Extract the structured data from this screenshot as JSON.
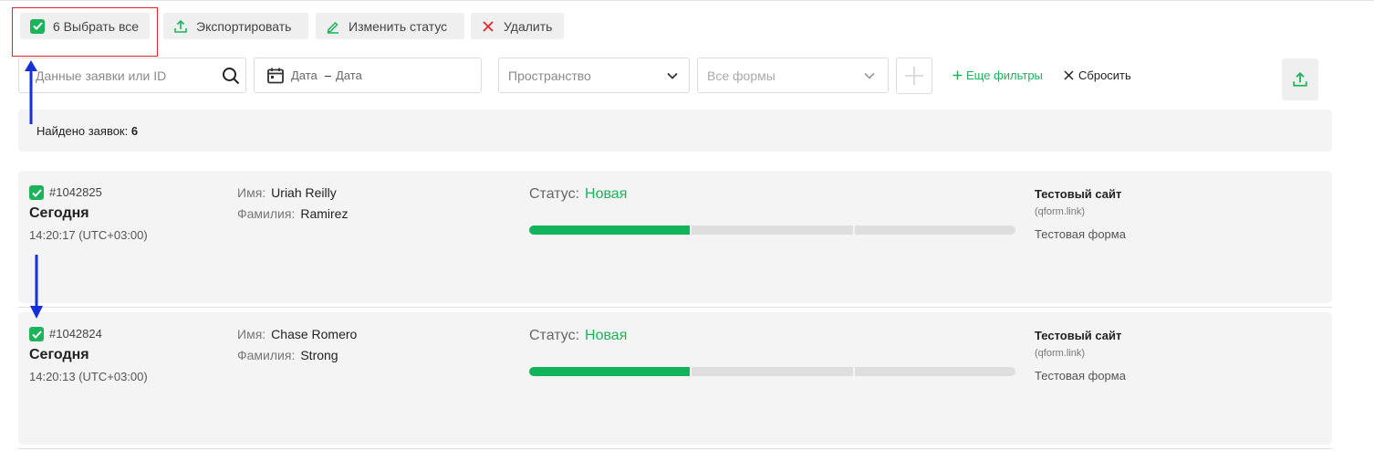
{
  "toolbar": {
    "select_all_label": "6 Выбрать все",
    "export_label": "Экспортировать",
    "change_status_label": "Изменить статус",
    "delete_label": "Удалить"
  },
  "filters": {
    "search_placeholder": "Данные заявки или ID",
    "date_from": "Дата",
    "date_sep": "–",
    "date_to": "Дата",
    "space_placeholder": "Пространство",
    "forms_placeholder": "Все формы",
    "more_filters_label": "Еще фильтры",
    "reset_label": "Сбросить"
  },
  "results": {
    "found_label": "Найдено заявок:",
    "found_count": "6"
  },
  "requests": [
    {
      "id": "#1042825",
      "day": "Сегодня",
      "time": "14:20:17 (UTC+03:00)",
      "first_name_label": "Имя:",
      "first_name": "Uriah Reilly",
      "last_name_label": "Фамилия:",
      "last_name": "Ramirez",
      "status_label": "Статус:",
      "status": "Новая",
      "progress_step": 1,
      "progress_total": 3,
      "site": "Тестовый сайт",
      "site_url": "(qform.link)",
      "form": "Тестовая форма"
    },
    {
      "id": "#1042824",
      "day": "Сегодня",
      "time": "14:20:13 (UTC+03:00)",
      "first_name_label": "Имя:",
      "first_name": "Chase Romero",
      "last_name_label": "Фамилия:",
      "last_name": "Strong",
      "status_label": "Статус:",
      "status": "Новая",
      "progress_step": 1,
      "progress_total": 3,
      "site": "Тестовый сайт",
      "site_url": "(qform.link)",
      "form": "Тестовая форма"
    }
  ],
  "colors": {
    "accent_green": "#1db35a",
    "delete_red": "#e0262e",
    "annotation_red": "#e0262e",
    "annotation_blue": "#1530d6"
  }
}
